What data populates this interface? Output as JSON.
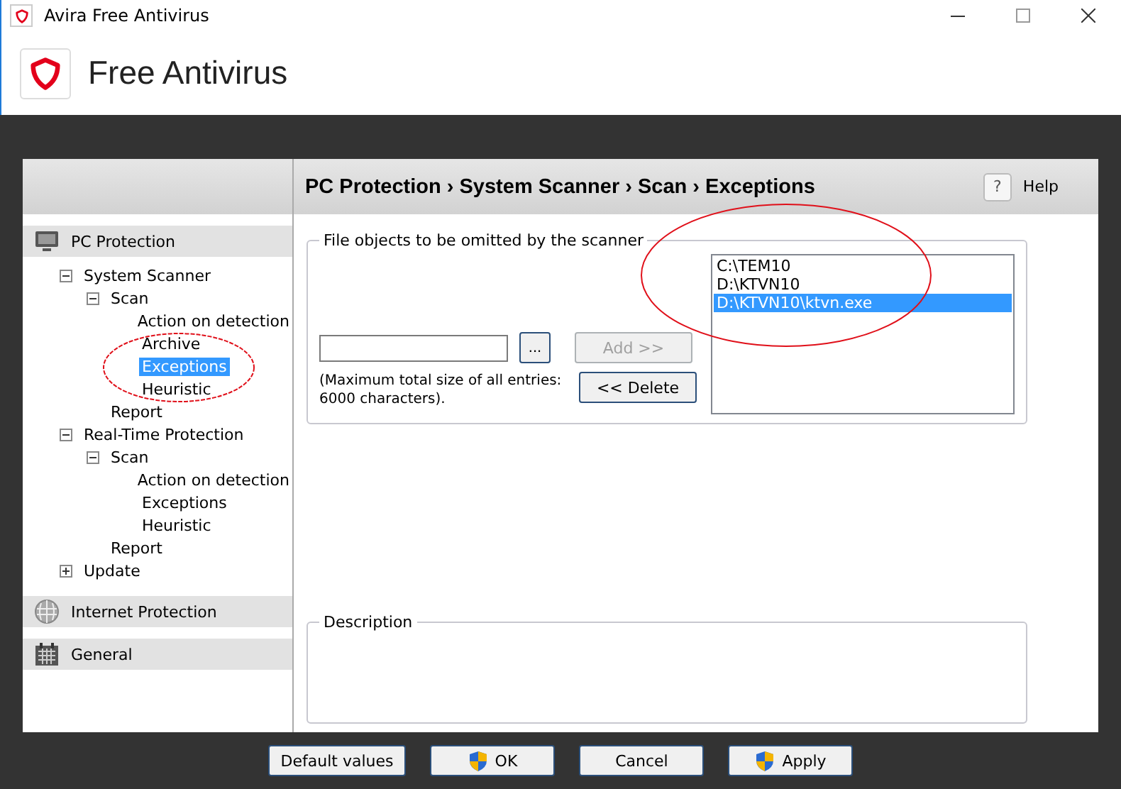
{
  "window": {
    "title": "Avira Free Antivirus"
  },
  "header": {
    "title": "Free Antivirus"
  },
  "breadcrumb": "PC Protection › System Scanner › Scan › Exceptions",
  "help": {
    "label": "Help",
    "icon_text": "?"
  },
  "sidebar": {
    "sections": [
      {
        "kind": "monitor",
        "label": "PC Protection",
        "tree": [
          {
            "label": "System Scanner",
            "expanded": true,
            "selected": false,
            "children": [
              {
                "label": "Scan",
                "expanded": true,
                "selected": false,
                "children": [
                  {
                    "label": "Action on detection",
                    "selected": false
                  },
                  {
                    "label": "Archive",
                    "selected": false
                  },
                  {
                    "label": "Exceptions",
                    "selected": true
                  },
                  {
                    "label": "Heuristic",
                    "selected": false
                  }
                ]
              },
              {
                "label": "Report",
                "selected": false
              }
            ]
          },
          {
            "label": "Real-Time Protection",
            "expanded": true,
            "selected": false,
            "children": [
              {
                "label": "Scan",
                "expanded": true,
                "selected": false,
                "children": [
                  {
                    "label": "Action on detection",
                    "selected": false
                  },
                  {
                    "label": "Exceptions",
                    "selected": false
                  },
                  {
                    "label": "Heuristic",
                    "selected": false
                  }
                ]
              },
              {
                "label": "Report",
                "selected": false
              }
            ]
          },
          {
            "label": "Update",
            "expanded": false,
            "selected": false
          }
        ]
      },
      {
        "kind": "globe",
        "label": "Internet Protection"
      },
      {
        "kind": "calendar",
        "label": "General"
      }
    ]
  },
  "exceptions": {
    "legend": "File objects to be omitted by the scanner",
    "browse_label": "...",
    "add": {
      "label": "Add >>",
      "disabled": true
    },
    "delete": {
      "label": "<< Delete",
      "disabled": false
    },
    "note": "(Maximum total size of all entries: 6000 characters).",
    "entries": [
      {
        "path": "C:\\TEM10",
        "selected": false
      },
      {
        "path": "D:\\KTVN10",
        "selected": false
      },
      {
        "path": "D:\\KTVN10\\ktvn.exe",
        "selected": true
      }
    ]
  },
  "description": {
    "legend": "Description"
  },
  "buttons": [
    {
      "label": "Default values",
      "shield": false
    },
    {
      "label": "OK",
      "shield": true
    },
    {
      "label": "Cancel",
      "shield": false
    },
    {
      "label": "Apply",
      "shield": true
    }
  ]
}
